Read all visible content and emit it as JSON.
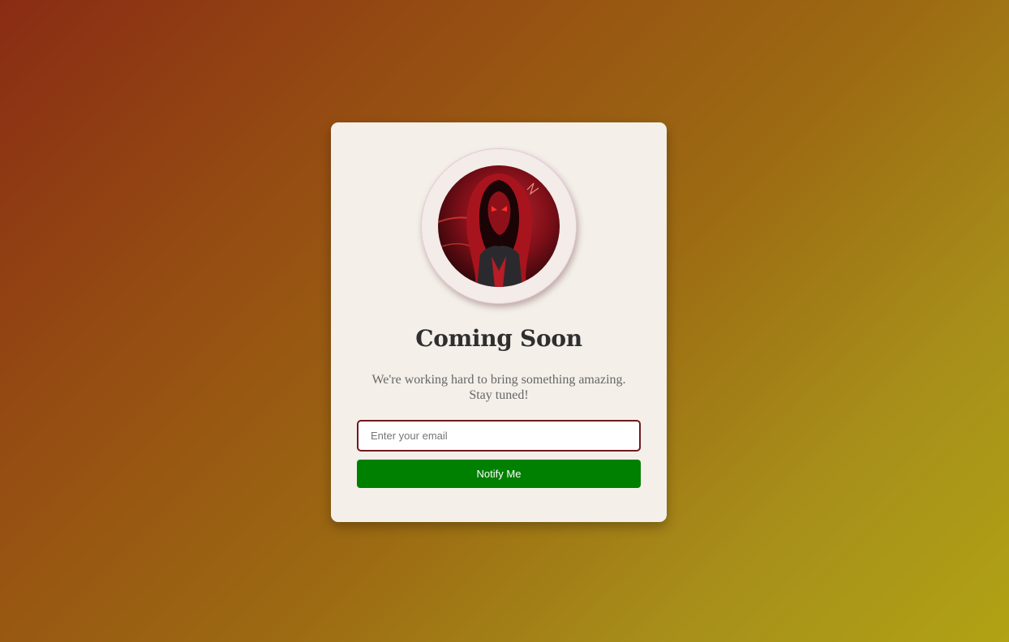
{
  "card": {
    "title": "Coming Soon",
    "subtitle": "We're working hard to bring something amazing. Stay tuned!",
    "email_placeholder": "Enter your email",
    "email_value": "",
    "button_label": "Notify Me",
    "avatar_icon": "hooded-figure-avatar"
  },
  "colors": {
    "background_gradient": [
      "#8a2c14",
      "#b0a214"
    ],
    "card": "#f4efe9",
    "button": "#008000",
    "input_border": "#6e1a1e",
    "title": "#2f2f2f",
    "subtitle": "#666666"
  }
}
